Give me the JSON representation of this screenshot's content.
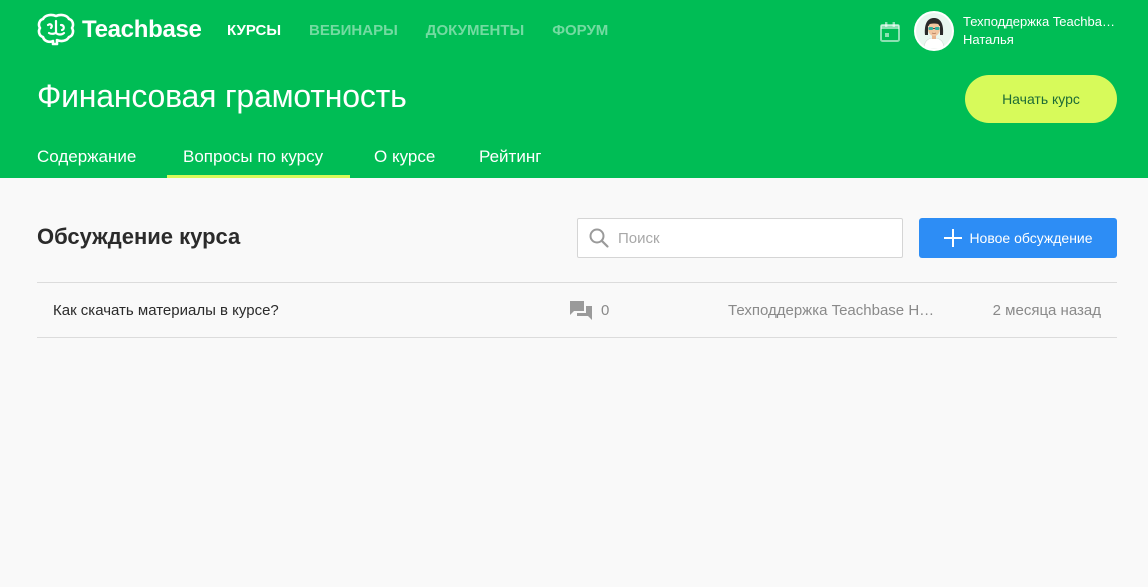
{
  "brand": {
    "name": "Teachbase"
  },
  "topnav": [
    {
      "label": "КУРСЫ",
      "active": true
    },
    {
      "label": "ВЕБИНАРЫ",
      "active": false
    },
    {
      "label": "ДОКУМЕНТЫ",
      "active": false
    },
    {
      "label": "ФОРУМ",
      "active": false
    }
  ],
  "user": {
    "name": "Техподдержка Teachbase",
    "subtitle": "Наталья"
  },
  "course": {
    "title": "Финансовая грамотность",
    "start_label": "Начать курс"
  },
  "tabs": [
    {
      "label": "Содержание",
      "active": false
    },
    {
      "label": "Вопросы по курсу",
      "active": true
    },
    {
      "label": "О курсе",
      "active": false
    },
    {
      "label": "Рейтинг",
      "active": false
    }
  ],
  "discussion": {
    "title": "Обсуждение курса",
    "search_placeholder": "Поиск",
    "new_label": "Новое обсуждение",
    "threads": [
      {
        "title": "Как скачать материалы в курсе?",
        "comments": "0",
        "author": "Техподдержка Teachbase Наталья",
        "time": "2 месяца назад"
      }
    ]
  },
  "colors": {
    "header": "#00bd55",
    "accent": "#d7fa5a",
    "primary_button": "#2d8df5"
  },
  "icons": [
    "brain-logo-icon",
    "calendar-icon",
    "avatar",
    "search-icon",
    "plus-icon",
    "comments-icon"
  ]
}
